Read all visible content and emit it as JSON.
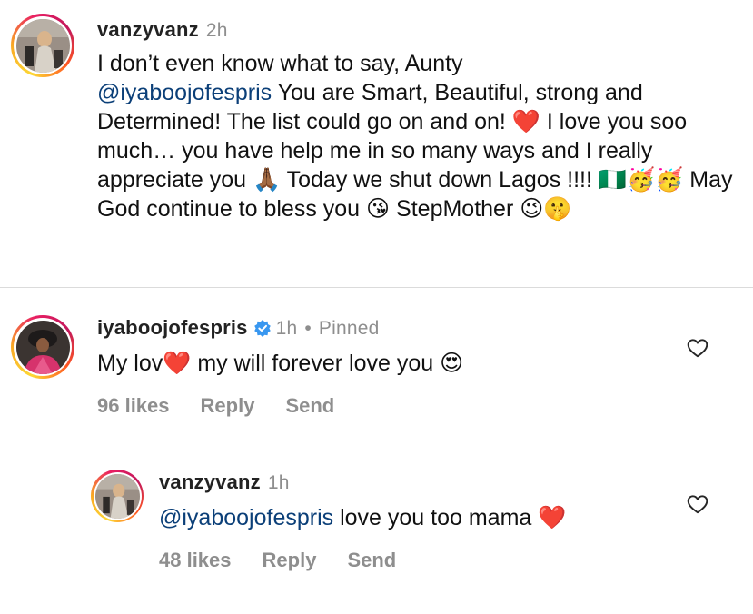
{
  "comments": [
    {
      "username": "vanzyvanz",
      "time": "2h",
      "text_parts": {
        "p1": "I don’t even know what to say, Aunty",
        "mention": "@iyaboojofespris",
        "p2": "You are Smart, Beautiful, strong and Determined! The list could go on and on!",
        "p3": "I love you soo much… you have help me in so many ways and I really appreciate you",
        "p4": "Today we shut down Lagos !!!!",
        "p5": "May God continue to bless you",
        "p6": "StepMother"
      },
      "emojis": {
        "heart": "❤️",
        "pray": "🙏🏾",
        "flag": "🇳🇬",
        "party1": "🥳",
        "party2": "🥳",
        "kiss": "😘",
        "wink": "😉",
        "shush": "🤫"
      }
    },
    {
      "username": "iyaboojofespris",
      "time": "1h",
      "pinned": "Pinned",
      "separator": "•",
      "text_parts": {
        "p1": "My lov",
        "p2": "my will forever love you"
      },
      "emojis": {
        "heart": "❤️",
        "heart_eyes": "😍"
      },
      "likes": "96 likes",
      "reply": "Reply",
      "send": "Send"
    },
    {
      "username": "vanzyvanz",
      "time": "1h",
      "text_parts": {
        "mention": "@iyaboojofespris",
        "p1": "love you too mama"
      },
      "emojis": {
        "heart": "❤️"
      },
      "likes": "48 likes",
      "reply": "Reply",
      "send": "Send"
    }
  ],
  "colors": {
    "mention": "#0b3f78",
    "meta": "#8e8e8e",
    "verified": "#3897f0",
    "divider": "#dbdbdb"
  },
  "icons": [
    "heart-outline-icon",
    "verified-badge-icon",
    "avatar"
  ]
}
